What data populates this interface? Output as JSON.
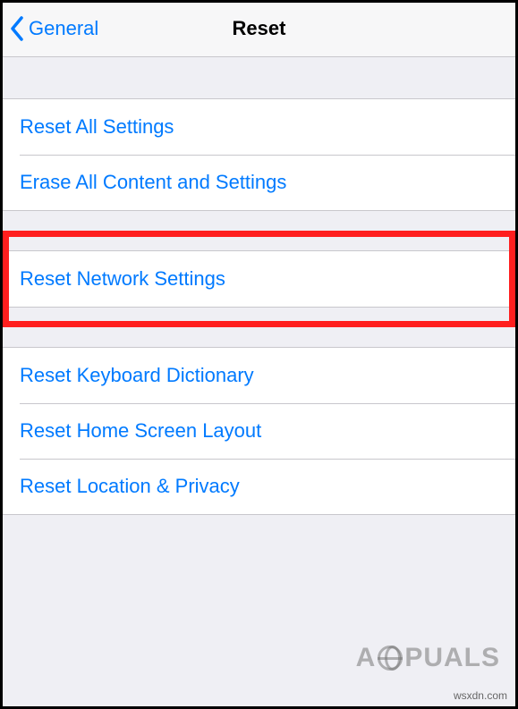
{
  "nav": {
    "back_label": "General",
    "title": "Reset"
  },
  "groups": {
    "g1": {
      "items": [
        {
          "label": "Reset All Settings"
        },
        {
          "label": "Erase All Content and Settings"
        }
      ]
    },
    "g2": {
      "items": [
        {
          "label": "Reset Network Settings"
        }
      ]
    },
    "g3": {
      "items": [
        {
          "label": "Reset Keyboard Dictionary"
        },
        {
          "label": "Reset Home Screen Layout"
        },
        {
          "label": "Reset Location & Privacy"
        }
      ]
    }
  },
  "watermark": {
    "prefix": "A",
    "suffix": "PUALS"
  },
  "credit": "wsxdn.com"
}
